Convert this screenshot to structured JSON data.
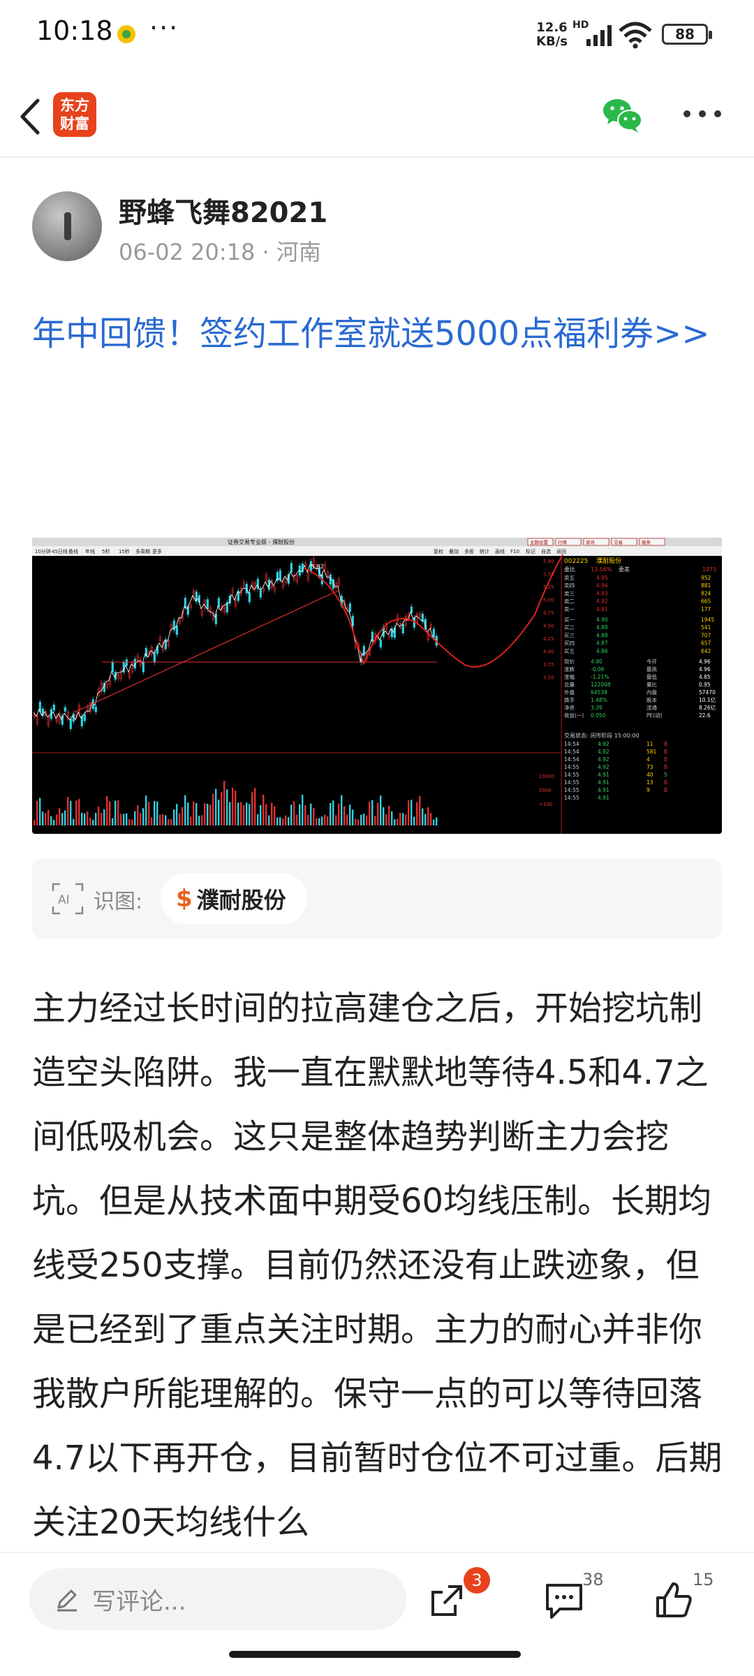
{
  "status_bar": {
    "time": "10:18",
    "more": "···",
    "net_speed_value": "12.6",
    "net_speed_unit": "KB/s",
    "network_type": "HD",
    "battery": "88"
  },
  "nav": {
    "back_icon": "chevron-left-icon",
    "logo_line1": "东方",
    "logo_line2": "财富",
    "logo_color": "#e8421d",
    "wechat_icon": "wechat-icon",
    "menu_icon": "more-horizontal-icon"
  },
  "author": {
    "name": "野蜂飞舞82021",
    "date": "06-02 20:18",
    "separator": "·",
    "location": "河南"
  },
  "promo": {
    "text": "年中回馈！签约工作室就送5000点福利券>>",
    "color": "#2a6ad1"
  },
  "chart_image": {
    "window_title": "证券交易专业版 - 濮耐股份",
    "toolbar_items": [
      "10分钟",
      "45日线",
      "备线",
      "年线",
      "5秒",
      "15秒",
      "多周期",
      "更多"
    ],
    "right_toolbar_items": [
      "复权",
      "叠加",
      "多股",
      "统计",
      "画线",
      "F10",
      "标记",
      "自选",
      "返回"
    ],
    "top_buttons": [
      "主题设置",
      "行情",
      "资讯",
      "交易",
      "服务"
    ],
    "stock_code": "002225",
    "stock_name": "濮耐股份",
    "y_ticks": [
      "5.80",
      "5.50",
      "5.25",
      "5.00",
      "4.75",
      "4.50",
      "4.25",
      "4.00",
      "3.75",
      "3.50"
    ],
    "ratio_label": "委比",
    "ratio_value": "13.56%",
    "diff_label": "委差",
    "diff_value": "1073",
    "asks": [
      {
        "label": "卖五",
        "price": "4.95",
        "vol": "952"
      },
      {
        "label": "卖四",
        "price": "4.94",
        "vol": "881"
      },
      {
        "label": "卖三",
        "price": "4.93",
        "vol": "824"
      },
      {
        "label": "卖二",
        "price": "4.92",
        "vol": "665"
      },
      {
        "label": "卖一",
        "price": "4.91",
        "vol": "177"
      }
    ],
    "bids": [
      {
        "label": "买一",
        "price": "4.90",
        "vol": "1945"
      },
      {
        "label": "买二",
        "price": "4.89",
        "vol": "541"
      },
      {
        "label": "买三",
        "price": "4.88",
        "vol": "707"
      },
      {
        "label": "买四",
        "price": "4.87",
        "vol": "657"
      },
      {
        "label": "买五",
        "price": "4.86",
        "vol": "642"
      }
    ],
    "quote_rows": [
      {
        "k1": "现价",
        "v1": "4.90",
        "k2": "今开",
        "v2": "4.96"
      },
      {
        "k1": "涨跌",
        "v1": "-0.06",
        "k2": "最高",
        "v2": "4.96"
      },
      {
        "k1": "涨幅",
        "v1": "-1.21%",
        "k2": "最低",
        "v2": "4.85"
      },
      {
        "k1": "总量",
        "v1": "122008",
        "k2": "量比",
        "v2": "0.95"
      },
      {
        "k1": "外盘",
        "v1": "64538",
        "k2": "内盘",
        "v2": "57470"
      },
      {
        "k1": "换手",
        "v1": "1.48%",
        "k2": "股本",
        "v2": "10.1亿"
      },
      {
        "k1": "净资",
        "v1": "3.39",
        "k2": "流通",
        "v2": "8.26亿"
      },
      {
        "k1": "收益(一)",
        "v1": "0.050",
        "k2": "PE(动)",
        "v2": "22.6"
      }
    ],
    "trade_status": "交易状态: 闭市阶段 15:00:00",
    "ticks": [
      {
        "time": "14:54",
        "price": "4.92",
        "vol": "11",
        "side": "B"
      },
      {
        "time": "14:54",
        "price": "4.92",
        "vol": "581",
        "side": "B"
      },
      {
        "time": "14:54",
        "price": "4.92",
        "vol": "4",
        "side": "B"
      },
      {
        "time": "14:55",
        "price": "4.92",
        "vol": "73",
        "side": "B"
      },
      {
        "time": "14:55",
        "price": "4.91",
        "vol": "40",
        "side": "S"
      },
      {
        "time": "14:55",
        "price": "4.91",
        "vol": "13",
        "side": "B"
      },
      {
        "time": "14:55",
        "price": "4.91",
        "vol": "9",
        "side": "B"
      },
      {
        "time": "14:55",
        "price": "4.91",
        "vol": "",
        "side": ""
      }
    ],
    "volume_ticks": [
      "10000",
      "5000",
      "×100"
    ],
    "peak_label": "5.82",
    "colors": {
      "up": "#e03030",
      "down": "#30d0e0",
      "bg": "#000000",
      "forecast": "#e02020"
    }
  },
  "ai_recognition": {
    "icon": "ai-scan-icon",
    "label": "识图:",
    "chip_symbol": "$",
    "chip_name": "濮耐股份"
  },
  "body": {
    "text": "主力经过长时间的拉高建仓之后，开始挖坑制造空头陷阱。我一直在默默地等待4.5和4.7之间低吸机会。这只是整体趋势判断主力会挖坑。但是从技术面中期受60均线压制。长期均线受250支撑。目前仍然还没有止跌迹象，但是已经到了重点关注时期。主力的耐心并非你我散户所能理解的。保守一点的可以等待回落4.7以下再开仓，目前暂时仓位不可过重。后期关注20天均线什么"
  },
  "bottom_bar": {
    "comment_placeholder": "写评论...",
    "share_badge": "3",
    "comment_count": "38",
    "like_count": "15"
  }
}
